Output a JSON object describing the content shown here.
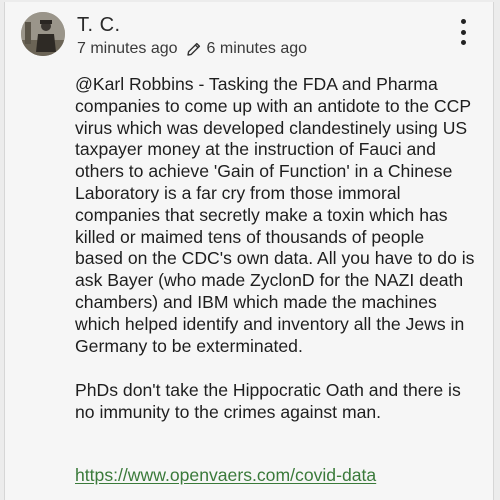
{
  "comment": {
    "author": "T. C.",
    "posted_time": "7 minutes ago",
    "edited_time": "6 minutes ago",
    "edit_icon": "pencil-icon",
    "menu_icon": "kebab-menu-icon",
    "paragraph_1": "@Karl Robbins - Tasking the FDA and Pharma companies to come up with an antidote to the CCP virus which was developed clandestinely using US taxpayer money at the instruction of Fauci and others to achieve 'Gain of Function' in a Chinese Laboratory is a far cry from those immoral companies that secretly make a toxin which has killed or maimed tens of thousands of people based on the CDC's own data. All you have to do is ask Bayer (who made ZyclonD for the NAZI death chambers) and IBM which made the machines which helped identify and inventory all the Jews in Germany to be exterminated.",
    "paragraph_2": "PhDs don't take the Hippocratic Oath and there is no immunity to the crimes against man.",
    "link_text": "https://www.openvaers.com/covid-data"
  },
  "colors": {
    "link": "#3a7a3a",
    "text": "#1e1e1e",
    "background": "#f6f6f6"
  }
}
